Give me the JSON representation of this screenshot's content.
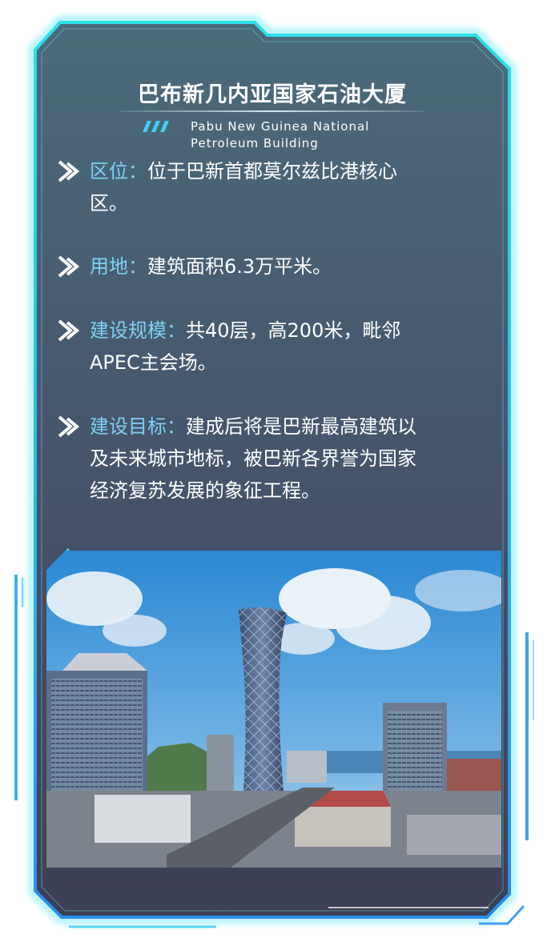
{
  "header": {
    "title": "巴布新几内亚国家石油大厦",
    "subtitle_line1": "Pabu New Guinea National",
    "subtitle_line2": "Petroleum Building"
  },
  "sections": [
    {
      "label": "区位：",
      "text_line1": "位于巴新首都莫尔兹比港核心",
      "text_line2": "区。",
      "text_line3": ""
    },
    {
      "label": "用地：",
      "text_line1": "建筑面积6.3万平米。",
      "text_line2": "",
      "text_line3": ""
    },
    {
      "label": "建设规模：",
      "text_line1": "共40层，高200米，毗邻",
      "text_line2": "APEC主会场。",
      "text_line3": ""
    },
    {
      "label": "建设目标：",
      "text_line1": "建成后将是巴新最高建筑以",
      "text_line2": "及未来城市地标，被巴新各界誉为国家",
      "text_line3": "经济复苏发展的象征工程。"
    }
  ],
  "colors": {
    "panel_top": "#4a6a7a",
    "panel_bottom": "#3f4156",
    "frame_glow": "#22d3e6",
    "label": "#7fd0f5",
    "text": "#ffffff"
  },
  "icons": {
    "bullet": "double-chevron-right-icon"
  }
}
